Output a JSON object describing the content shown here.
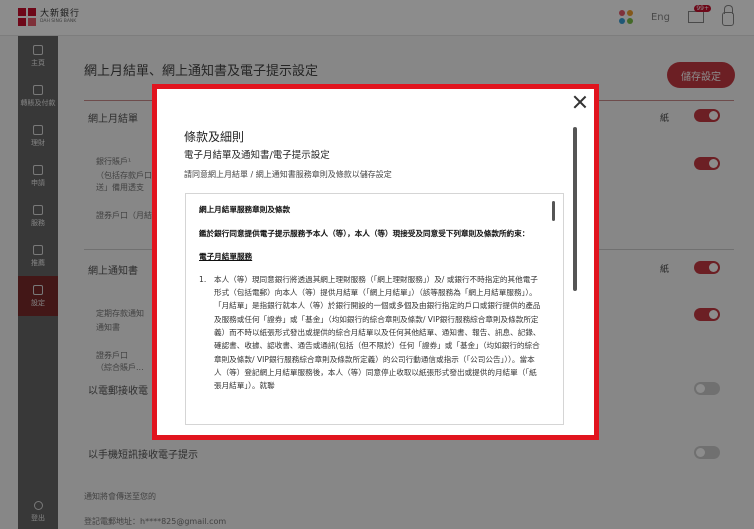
{
  "header": {
    "logo_zh": "大新銀行",
    "logo_en": "DAH SING BANK",
    "language": "Eng",
    "mail_badge": "99+"
  },
  "sidebar": {
    "items": [
      {
        "label": "主頁"
      },
      {
        "label": "轉賬及付款"
      },
      {
        "label": "理財"
      },
      {
        "label": "申請"
      },
      {
        "label": "服務"
      },
      {
        "label": "推薦"
      },
      {
        "label": "設定"
      }
    ],
    "logout": "登出"
  },
  "page": {
    "title": "網上月結單、網上通知書及電子提示設定",
    "save_label": "儲存設定",
    "rows": {
      "monthly": "網上月結單",
      "account": "銀行賬戶¹",
      "account_note1": "（包括存款戶口",
      "account_note2": "送」備用透支",
      "securities": "證券戶口（月結",
      "advice": "網上通知書",
      "fixed_deposit1": "定期存款通知",
      "fixed_deposit2": "通知書",
      "securities_acc": "證券戶口",
      "securities_note": "（綜合賬戶...",
      "email_alert": "以電郵接收電",
      "sms_alert": "以手機短訊接收電子提示",
      "notify": "通知將會傳送至您的",
      "email_label": "登記電郵地址：",
      "email_value": "h****825@gmail.com",
      "paper_label": "紙"
    }
  },
  "modal": {
    "title": "條款及細則",
    "subtitle": "電子月結單及通知書/電子提示設定",
    "description": "請同意網上月結單 / 網上通知書服務章則及條款以儲存設定",
    "terms": {
      "heading": "網上月結單服務章則及條款",
      "intro": "鑑於銀行同意提供電子提示服務予本人（等），本人（等）現接受及同意受下列章則及條款所約束：",
      "section": "電子月結單服務",
      "item1_num": "1.",
      "item1_text": "本人（等）現同意銀行將透過其網上理財服務（「網上理財服務」）及/ 或銀行不時指定的其他電子形式（包括電郵）向本人（等）提供月結單（「網上月結單」）（該等服務為「網上月結單服務」）。「月結單」是指銀行就本人（等）於銀行開設的一個或多個及由銀行指定的戶口或銀行提供的產品及服務或任何「證券」或「基金」（均如銀行的綜合章則及條款/ VIP銀行服務綜合章則及條款所定義）而不時以紙張形式發出或提供的綜合月結單以及任何其他結單、通知書、報告、訊息、記錄、確認書、收據、認收書、通告或通訊(包括（但不限於）任何「證券」或「基金」（均如銀行的綜合章則及條款/ VIP銀行服務綜合章則及條款所定義）的公司行動通信或指示（「公司公告」））。當本人（等）登記網上月結單服務後，本人（等）同意停止收取以紙張形式發出或提供的月結單（「紙張月結單」）。就聯"
    }
  },
  "colors": {
    "brand_red": "#c8102e",
    "modal_border": "#e1141e",
    "toggle_on": "#c53a42"
  }
}
